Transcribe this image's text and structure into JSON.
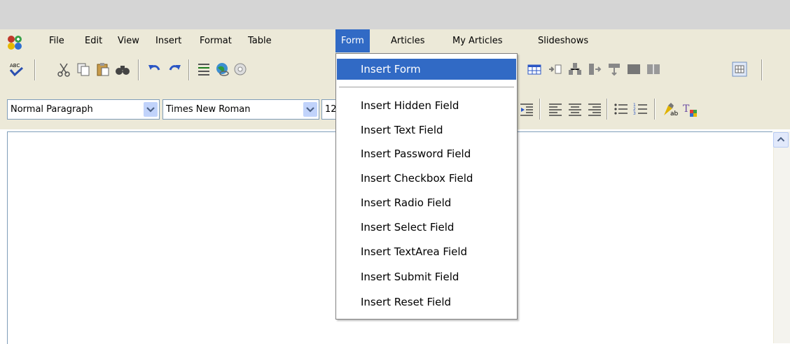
{
  "menubar": {
    "items": [
      "File",
      "Edit",
      "View",
      "Insert",
      "Format",
      "Table",
      "Form",
      "Articles",
      "My Articles",
      "Slideshows"
    ],
    "active": "Form"
  },
  "toolbar2": {
    "paragraph_style": "Normal Paragraph",
    "font_family": "Times New Roman",
    "font_size": "12"
  },
  "form_menu": {
    "items": [
      "Insert Form",
      "Insert Hidden Field",
      "Insert Text Field",
      "Insert Password Field",
      "Insert Checkbox Field",
      "Insert Radio Field",
      "Insert Select Field",
      "Insert TextArea Field",
      "Insert Submit Field",
      "Insert Reset Field"
    ],
    "highlighted": "Insert Form"
  },
  "icons": [
    "app-logo-icon",
    "spellcheck-icon",
    "cut-icon",
    "copy-icon",
    "paste-icon",
    "find-icon",
    "undo-icon",
    "redo-icon",
    "horizontal-rule-icon",
    "insert-link-icon",
    "insert-image-icon",
    "table-icon",
    "insert-row-icon",
    "insert-column-icon",
    "delete-column-icon",
    "delete-row-icon",
    "merge-cells-icon",
    "split-cells-icon",
    "table-borders-icon",
    "outdent-icon",
    "align-left-icon",
    "align-center-icon",
    "align-right-icon",
    "bullet-list-icon",
    "numbered-list-icon",
    "highlight-color-icon",
    "text-color-icon",
    "combo-arrow-icon",
    "scroll-up-arrow-icon"
  ]
}
